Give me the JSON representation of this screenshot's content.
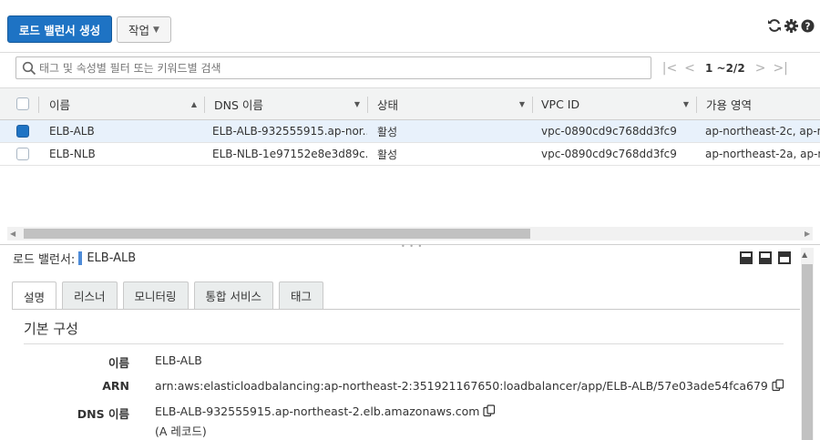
{
  "toolbar": {
    "create_label": "로드 밸런서 생성",
    "actions_label": "작업",
    "icons": [
      "refresh-icon",
      "gear-icon",
      "help-icon"
    ]
  },
  "search": {
    "placeholder": "태그 및 속성별 필터 또는 키워드별 검색"
  },
  "pager": {
    "info": "1 ~2/2"
  },
  "table": {
    "headers": [
      "이름",
      "DNS 이름",
      "상태",
      "VPC ID",
      "가용 영역"
    ],
    "rows": [
      {
        "selected": true,
        "name": "ELB-ALB",
        "dns": "ELB-ALB-932555915.ap-nor...",
        "state": "활성",
        "vpc": "vpc-0890cd9c768dd3fc9",
        "az": "ap-northeast-2c, ap-nor"
      },
      {
        "selected": false,
        "name": "ELB-NLB",
        "dns": "ELB-NLB-1e97152e8e3d89c...",
        "state": "활성",
        "vpc": "vpc-0890cd9c768dd3fc9",
        "az": "ap-northeast-2a, ap-nor"
      }
    ]
  },
  "detail": {
    "title_prefix": "로드 밸런서:",
    "title_name": "ELB-ALB",
    "tabs": [
      "설명",
      "리스너",
      "모니터링",
      "통합 서비스",
      "태그"
    ],
    "active_tab": "설명",
    "section_title": "기본 구성",
    "fields": {
      "name_label": "이름",
      "name_value": "ELB-ALB",
      "arn_label": "ARN",
      "arn_value": "arn:aws:elasticloadbalancing:ap-northeast-2:351921167650:loadbalancer/app/ELB-ALB/57e03ade54fca679",
      "dns_label": "DNS 이름",
      "dns_value": "ELB-ALB-932555915.ap-northeast-2.elb.amazonaws.com",
      "dns_note": "(A 레코드)"
    }
  },
  "colors": {
    "primary": "#1e73c4",
    "selected_row": "#e8f1fb",
    "header_bg": "#f2f3f3"
  }
}
